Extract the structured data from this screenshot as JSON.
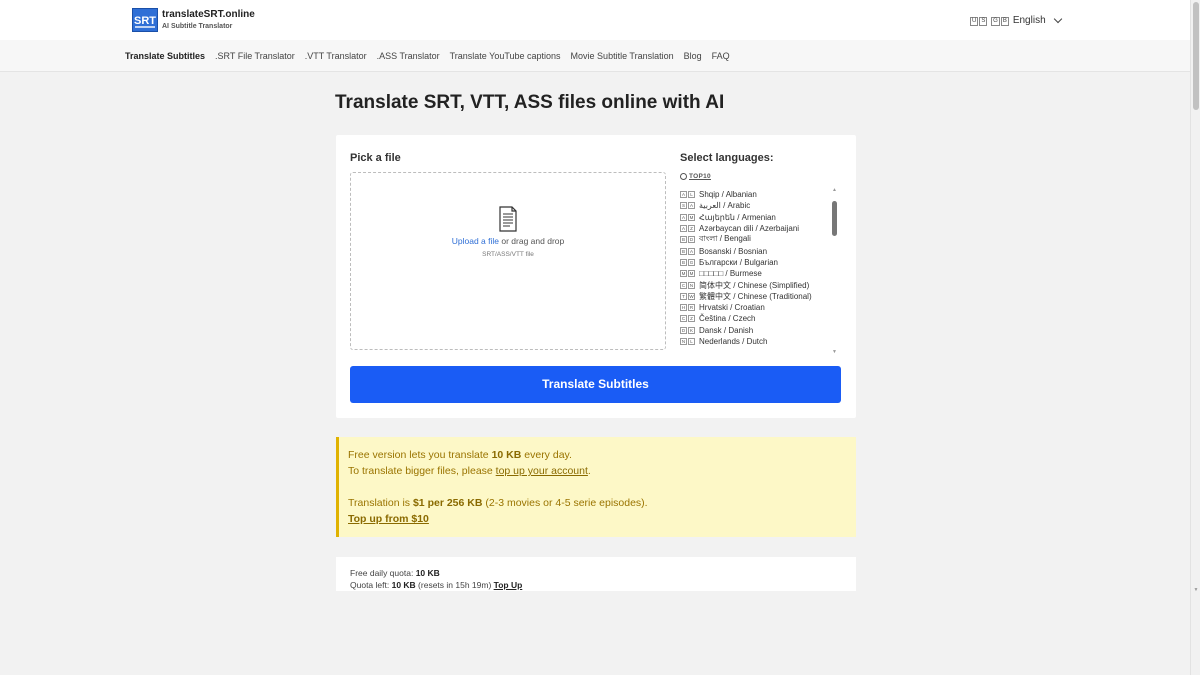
{
  "brand": {
    "logo_text": "SRT",
    "name": "translateSRT.online",
    "subtitle": "AI Subtitle Translator"
  },
  "language_switch": {
    "flag_codes": [
      "U",
      "S",
      "G",
      "B"
    ],
    "label": "English",
    "icon": "chevron-down-icon"
  },
  "nav": {
    "items": [
      {
        "label": "Translate Subtitles",
        "active": true
      },
      {
        "label": ".SRT File Translator"
      },
      {
        "label": ".VTT Translator"
      },
      {
        "label": ".ASS Translator"
      },
      {
        "label": "Translate YouTube captions"
      },
      {
        "label": "Movie Subtitle Translation"
      },
      {
        "label": "Blog"
      },
      {
        "label": "FAQ"
      }
    ]
  },
  "page_title": "Translate SRT, VTT, ASS files online with AI",
  "upload": {
    "label": "Pick a file",
    "link_text": "Upload a file",
    "rest_text": " or drag and drop",
    "hint": "SRT/ASS/VTT file",
    "icon": "document-icon"
  },
  "languages": {
    "label": "Select languages:",
    "top10": "TOP10",
    "items": [
      {
        "flag": [
          "A",
          "L"
        ],
        "label": "Shqip / Albanian"
      },
      {
        "flag": [
          "S",
          "A"
        ],
        "label": "العربية / Arabic"
      },
      {
        "flag": [
          "A",
          "M"
        ],
        "label": "Հայերեն / Armenian"
      },
      {
        "flag": [
          "A",
          "Z"
        ],
        "label": "Azərbaycan dili / Azerbaijani"
      },
      {
        "flag": [
          "B",
          "D"
        ],
        "label": "বাংলা / Bengali"
      },
      {
        "flag": [
          "B",
          "A"
        ],
        "label": "Bosanski / Bosnian"
      },
      {
        "flag": [
          "B",
          "G"
        ],
        "label": "Български / Bulgarian"
      },
      {
        "flag": [
          "M",
          "M"
        ],
        "label": "□□□□□ / Burmese"
      },
      {
        "flag": [
          "C",
          "N"
        ],
        "label": "简体中文 / Chinese (Simplified)"
      },
      {
        "flag": [
          "T",
          "W"
        ],
        "label": "繁體中文 / Chinese (Traditional)"
      },
      {
        "flag": [
          "H",
          "R"
        ],
        "label": "Hrvatski / Croatian"
      },
      {
        "flag": [
          "C",
          "Z"
        ],
        "label": "Čeština / Czech"
      },
      {
        "flag": [
          "D",
          "K"
        ],
        "label": "Dansk / Danish"
      },
      {
        "flag": [
          "N",
          "L"
        ],
        "label": "Nederlands / Dutch"
      }
    ]
  },
  "translate_button": "Translate Subtitles",
  "notice": {
    "line1_pre": "Free version lets you translate ",
    "line1_bold": "10 KB",
    "line1_post": " every day.",
    "line2_pre": "To translate bigger files, please ",
    "line2_link": "top up your account",
    "line2_post": ".",
    "line3_pre": "Translation is ",
    "line3_bold": "$1 per 256 KB",
    "line3_post": " (2-3 movies or 4-5 serie episodes).",
    "line4_link": "Top up from $10"
  },
  "quota": {
    "daily_label": "Free daily quota: ",
    "daily_value": "10 KB",
    "left_label": "Quota left: ",
    "left_value": "10 KB",
    "reset_text": " (resets in 15h 19m) ",
    "topup_link": "Top Up"
  },
  "colors": {
    "accent": "#1a5cf5",
    "notice_bg": "#fdf8c7",
    "notice_border": "#e0b200"
  }
}
